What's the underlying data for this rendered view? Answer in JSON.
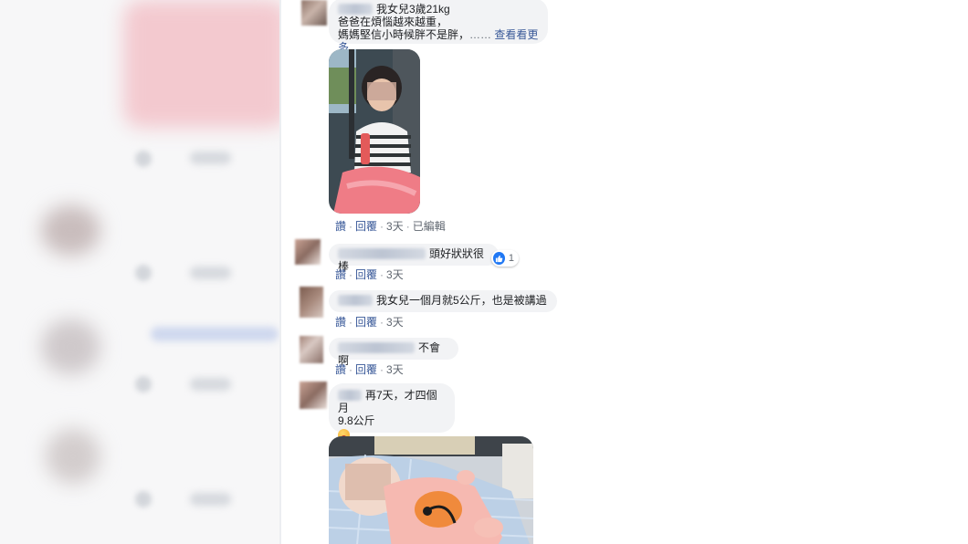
{
  "comments": [
    {
      "text_line1": "我女兒3歲21kg",
      "text_line2": "爸爸在煩惱越來越重，",
      "text_line3": "媽媽堅信小時候胖不是胖，",
      "ellipsis": "……",
      "see_more": "查看看更多",
      "actions": {
        "like": "讚",
        "reply": "回覆",
        "time": "3天",
        "edited": "已編輯"
      }
    },
    {
      "text": "頭好狀狀很棒",
      "reaction_count": "1",
      "actions": {
        "like": "讚",
        "reply": "回覆",
        "time": "3天"
      }
    },
    {
      "text": "我女兒一個月就5公斤，也是被講過",
      "actions": {
        "like": "讚",
        "reply": "回覆",
        "time": "3天"
      }
    },
    {
      "text": "不會啊",
      "actions": {
        "like": "讚",
        "reply": "回覆",
        "time": "3天"
      }
    },
    {
      "text_line1": "再7天，才四個月",
      "text_line2": "9.8公斤",
      "emoji": "blushing-face-emoji"
    }
  ],
  "colors": {
    "link": "#385898",
    "bubble": "#f2f3f5",
    "like_blue": "#2078f4",
    "meta": "#606770"
  }
}
